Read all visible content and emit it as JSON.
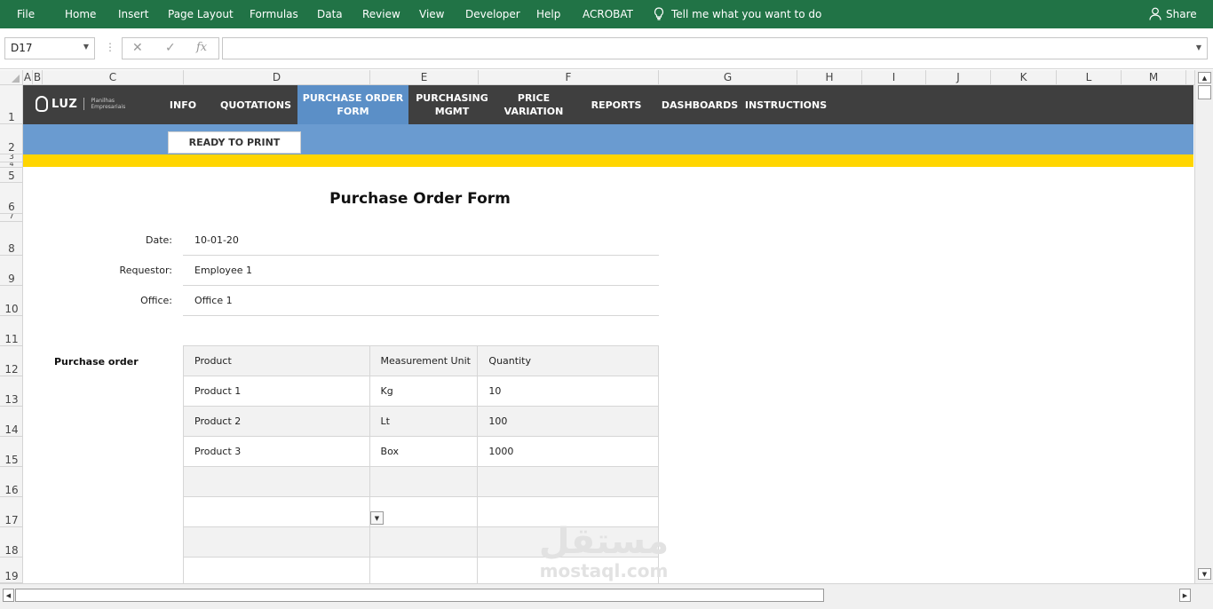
{
  "ribbon": {
    "tabs": [
      "File",
      "Home",
      "Insert",
      "Page Layout",
      "Formulas",
      "Data",
      "Review",
      "View",
      "Developer",
      "Help",
      "ACROBAT"
    ],
    "tell_me": "Tell me what you want to do",
    "share": "Share"
  },
  "formula_bar": {
    "name_box": "D17",
    "fx": "fx",
    "formula": ""
  },
  "columns": [
    "A",
    "B",
    "C",
    "D",
    "E",
    "F",
    "G",
    "H",
    "I",
    "J",
    "K",
    "L",
    "M"
  ],
  "rows": [
    "1",
    "2",
    "3",
    "4",
    "5",
    "6",
    "7",
    "8",
    "9",
    "10",
    "11",
    "12",
    "13",
    "14",
    "15",
    "16",
    "17",
    "18",
    "19"
  ],
  "nav": {
    "logo_brand": "LUZ",
    "logo_sub_1": "Planilhas",
    "logo_sub_2": "Empresariais",
    "items": [
      {
        "line1": "INFO",
        "line2": ""
      },
      {
        "line1": "QUOTATIONS",
        "line2": ""
      },
      {
        "line1": "PURCHASE ORDER",
        "line2": "FORM"
      },
      {
        "line1": "PURCHASING",
        "line2": "MGMT"
      },
      {
        "line1": "PRICE",
        "line2": "VARIATION"
      },
      {
        "line1": "REPORTS",
        "line2": ""
      },
      {
        "line1": "DASHBOARDS",
        "line2": ""
      },
      {
        "line1": "INSTRUCTIONS",
        "line2": ""
      }
    ],
    "active_index": 2
  },
  "print_button": "READY TO PRINT",
  "form": {
    "title": "Purchase Order Form",
    "date_label": "Date:",
    "date_value": "10-01-20",
    "requestor_label": "Requestor:",
    "requestor_value": "Employee 1",
    "office_label": "Office:",
    "office_value": "Office 1"
  },
  "purchase_order": {
    "label": "Purchase order",
    "headers": [
      "Product",
      "Measurement Unit",
      "Quantity"
    ],
    "rows": [
      [
        "Product 1",
        "Kg",
        "10"
      ],
      [
        "Product 2",
        "Lt",
        "100"
      ],
      [
        "Product 3",
        "Box",
        "1000"
      ],
      [
        "",
        "",
        ""
      ],
      [
        "",
        "",
        ""
      ],
      [
        "",
        "",
        ""
      ],
      [
        "",
        "",
        ""
      ]
    ]
  },
  "watermark": {
    "arabic": "مستقل",
    "latin": "mostaql.com"
  },
  "colors": {
    "ribbon": "#217346",
    "nav_bar": "#3f3f3f",
    "nav_active": "#5b8fc7",
    "blue_band": "#6a9bd0",
    "yellow_band": "#ffd500"
  }
}
